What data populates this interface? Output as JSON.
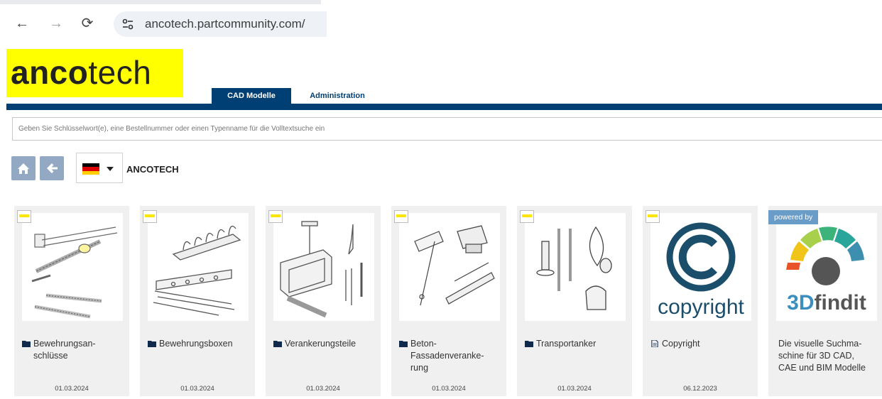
{
  "browser": {
    "url": "ancotech.partcommunity.com/"
  },
  "header": {
    "logo_bold": "anco",
    "logo_light": "tech",
    "tabs": [
      {
        "label": "CAD Modelle",
        "active": true
      },
      {
        "label": "Administration",
        "active": false
      }
    ],
    "accent_color": "#003f74",
    "logo_color": "#ffff00"
  },
  "search": {
    "placeholder": "Geben Sie Schlüsselwort(e), eine Bestellnummer oder einen Typenname für die Volltextsuche ein",
    "value": ""
  },
  "toolbar": {
    "home_icon": "home-icon",
    "back_icon": "arrow-left-icon",
    "language_flag": "german-flag",
    "breadcrumb": "ANCOTECH"
  },
  "cards": [
    {
      "title": "Bewehrungsan-\nschlüsse",
      "date": "01.03.2024",
      "icon": "folder-icon"
    },
    {
      "title": "Bewehrungsboxen",
      "date": "01.03.2024",
      "icon": "folder-icon"
    },
    {
      "title": "Verankerungsteile",
      "date": "01.03.2024",
      "icon": "folder-icon"
    },
    {
      "title": "Beton-\nFassadenveranke-\nrung",
      "date": "01.03.2024",
      "icon": "folder-icon"
    },
    {
      "title": "Transportanker",
      "date": "01.03.2024",
      "icon": "folder-icon"
    },
    {
      "title": "Copyright",
      "date": "06.12.2023",
      "icon": "document-icon",
      "image_text": "copyright"
    },
    {
      "title": "Die visuelle Suchma-\nschine für 3D CAD,\nCAE und BIM Modelle",
      "powered": "powered by",
      "logo_3d": "3D",
      "logo_findit": "findit"
    }
  ]
}
